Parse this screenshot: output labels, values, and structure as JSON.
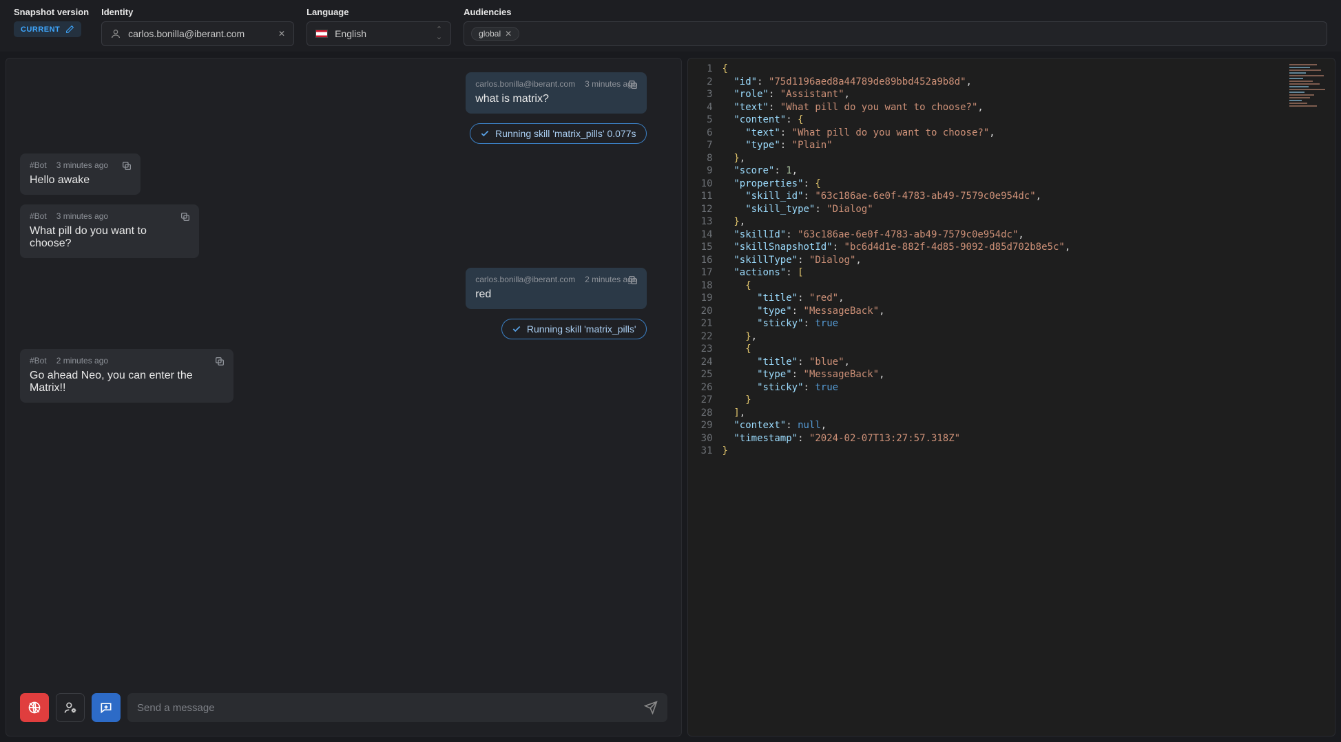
{
  "header": {
    "snapshot_label": "Snapshot version",
    "snapshot_badge": "CURRENT",
    "identity_label": "Identity",
    "identity_value": "carlos.bonilla@iberant.com",
    "language_label": "Language",
    "language_value": "English",
    "audiences_label": "Audiencies",
    "audience_tag": "global"
  },
  "chat": {
    "messages": [
      {
        "kind": "user",
        "sender": "carlos.bonilla@iberant.com",
        "time": "3 minutes ago",
        "text": "what is matrix?"
      },
      {
        "kind": "skill",
        "text": "Running skill 'matrix_pills' 0.077s"
      },
      {
        "kind": "bot",
        "sender": "#Bot",
        "time": "3 minutes ago",
        "text": "Hello awake",
        "size": "narrow"
      },
      {
        "kind": "bot",
        "sender": "#Bot",
        "time": "3 minutes ago",
        "text": "What pill do you want to choose?",
        "size": "med"
      },
      {
        "kind": "user",
        "sender": "carlos.bonilla@iberant.com",
        "time": "2 minutes ago",
        "text": "red"
      },
      {
        "kind": "skill",
        "text": "Running skill 'matrix_pills'"
      },
      {
        "kind": "bot",
        "sender": "#Bot",
        "time": "2 minutes ago",
        "text": "Go ahead Neo, you can enter the Matrix!!",
        "size": "wide"
      }
    ],
    "input_placeholder": "Send a message"
  },
  "code": {
    "lines": [
      [
        [
          "brace",
          "{"
        ]
      ],
      [
        [
          "punc",
          "  "
        ],
        [
          "key",
          "\"id\""
        ],
        [
          "punc",
          ": "
        ],
        [
          "str",
          "\"75d1196aed8a44789de89bbd452a9b8d\""
        ],
        [
          "punc",
          ","
        ]
      ],
      [
        [
          "punc",
          "  "
        ],
        [
          "key",
          "\"role\""
        ],
        [
          "punc",
          ": "
        ],
        [
          "str",
          "\"Assistant\""
        ],
        [
          "punc",
          ","
        ]
      ],
      [
        [
          "punc",
          "  "
        ],
        [
          "key",
          "\"text\""
        ],
        [
          "punc",
          ": "
        ],
        [
          "str",
          "\"What pill do you want to choose?\""
        ],
        [
          "punc",
          ","
        ]
      ],
      [
        [
          "punc",
          "  "
        ],
        [
          "key",
          "\"content\""
        ],
        [
          "punc",
          ": "
        ],
        [
          "brace",
          "{"
        ]
      ],
      [
        [
          "punc",
          "    "
        ],
        [
          "key",
          "\"text\""
        ],
        [
          "punc",
          ": "
        ],
        [
          "str",
          "\"What pill do you want to choose?\""
        ],
        [
          "punc",
          ","
        ]
      ],
      [
        [
          "punc",
          "    "
        ],
        [
          "key",
          "\"type\""
        ],
        [
          "punc",
          ": "
        ],
        [
          "str",
          "\"Plain\""
        ]
      ],
      [
        [
          "punc",
          "  "
        ],
        [
          "brace",
          "}"
        ],
        [
          "punc",
          ","
        ]
      ],
      [
        [
          "punc",
          "  "
        ],
        [
          "key",
          "\"score\""
        ],
        [
          "punc",
          ": "
        ],
        [
          "num",
          "1"
        ],
        [
          "punc",
          ","
        ]
      ],
      [
        [
          "punc",
          "  "
        ],
        [
          "key",
          "\"properties\""
        ],
        [
          "punc",
          ": "
        ],
        [
          "brace",
          "{"
        ]
      ],
      [
        [
          "punc",
          "    "
        ],
        [
          "key",
          "\"skill_id\""
        ],
        [
          "punc",
          ": "
        ],
        [
          "str",
          "\"63c186ae-6e0f-4783-ab49-7579c0e954dc\""
        ],
        [
          "punc",
          ","
        ]
      ],
      [
        [
          "punc",
          "    "
        ],
        [
          "key",
          "\"skill_type\""
        ],
        [
          "punc",
          ": "
        ],
        [
          "str",
          "\"Dialog\""
        ]
      ],
      [
        [
          "punc",
          "  "
        ],
        [
          "brace",
          "}"
        ],
        [
          "punc",
          ","
        ]
      ],
      [
        [
          "punc",
          "  "
        ],
        [
          "key",
          "\"skillId\""
        ],
        [
          "punc",
          ": "
        ],
        [
          "str",
          "\"63c186ae-6e0f-4783-ab49-7579c0e954dc\""
        ],
        [
          "punc",
          ","
        ]
      ],
      [
        [
          "punc",
          "  "
        ],
        [
          "key",
          "\"skillSnapshotId\""
        ],
        [
          "punc",
          ": "
        ],
        [
          "str",
          "\"bc6d4d1e-882f-4d85-9092-d85d702b8e5c\""
        ],
        [
          "punc",
          ","
        ]
      ],
      [
        [
          "punc",
          "  "
        ],
        [
          "key",
          "\"skillType\""
        ],
        [
          "punc",
          ": "
        ],
        [
          "str",
          "\"Dialog\""
        ],
        [
          "punc",
          ","
        ]
      ],
      [
        [
          "punc",
          "  "
        ],
        [
          "key",
          "\"actions\""
        ],
        [
          "punc",
          ": "
        ],
        [
          "brace",
          "["
        ]
      ],
      [
        [
          "punc",
          "    "
        ],
        [
          "brace",
          "{"
        ]
      ],
      [
        [
          "punc",
          "      "
        ],
        [
          "key",
          "\"title\""
        ],
        [
          "punc",
          ": "
        ],
        [
          "str",
          "\"red\""
        ],
        [
          "punc",
          ","
        ]
      ],
      [
        [
          "punc",
          "      "
        ],
        [
          "key",
          "\"type\""
        ],
        [
          "punc",
          ": "
        ],
        [
          "str",
          "\"MessageBack\""
        ],
        [
          "punc",
          ","
        ]
      ],
      [
        [
          "punc",
          "      "
        ],
        [
          "key",
          "\"sticky\""
        ],
        [
          "punc",
          ": "
        ],
        [
          "bool",
          "true"
        ]
      ],
      [
        [
          "punc",
          "    "
        ],
        [
          "brace",
          "}"
        ],
        [
          "punc",
          ","
        ]
      ],
      [
        [
          "punc",
          "    "
        ],
        [
          "brace",
          "{"
        ]
      ],
      [
        [
          "punc",
          "      "
        ],
        [
          "key",
          "\"title\""
        ],
        [
          "punc",
          ": "
        ],
        [
          "str",
          "\"blue\""
        ],
        [
          "punc",
          ","
        ]
      ],
      [
        [
          "punc",
          "      "
        ],
        [
          "key",
          "\"type\""
        ],
        [
          "punc",
          ": "
        ],
        [
          "str",
          "\"MessageBack\""
        ],
        [
          "punc",
          ","
        ]
      ],
      [
        [
          "punc",
          "      "
        ],
        [
          "key",
          "\"sticky\""
        ],
        [
          "punc",
          ": "
        ],
        [
          "bool",
          "true"
        ]
      ],
      [
        [
          "punc",
          "    "
        ],
        [
          "brace",
          "}"
        ]
      ],
      [
        [
          "punc",
          "  "
        ],
        [
          "brace",
          "]"
        ],
        [
          "punc",
          ","
        ]
      ],
      [
        [
          "punc",
          "  "
        ],
        [
          "key",
          "\"context\""
        ],
        [
          "punc",
          ": "
        ],
        [
          "null",
          "null"
        ],
        [
          "punc",
          ","
        ]
      ],
      [
        [
          "punc",
          "  "
        ],
        [
          "key",
          "\"timestamp\""
        ],
        [
          "punc",
          ": "
        ],
        [
          "str",
          "\"2024-02-07T13:27:57.318Z\""
        ]
      ],
      [
        [
          "brace",
          "}"
        ]
      ]
    ]
  }
}
